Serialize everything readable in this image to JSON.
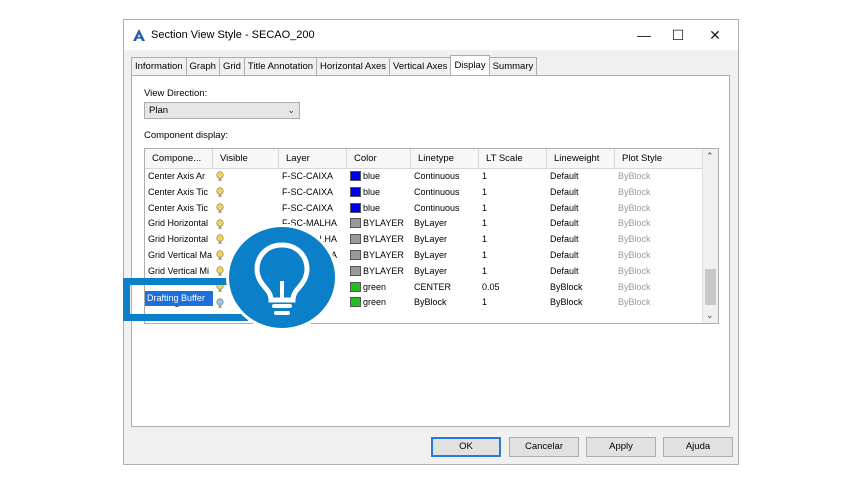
{
  "window": {
    "title": "Section View Style - SECAO_200",
    "minimize_glyph": "—",
    "maximize_glyph": "☐",
    "close_glyph": "✕"
  },
  "tabs": [
    {
      "label": "Information",
      "active": false
    },
    {
      "label": "Graph",
      "active": false
    },
    {
      "label": "Grid",
      "active": false
    },
    {
      "label": "Title Annotation",
      "active": false
    },
    {
      "label": "Horizontal Axes",
      "active": false
    },
    {
      "label": "Vertical Axes",
      "active": false
    },
    {
      "label": "Display",
      "active": true
    },
    {
      "label": "Summary",
      "active": false
    }
  ],
  "display": {
    "view_direction_label": "View Direction:",
    "view_direction_value": "Plan",
    "component_display_label": "Component display:",
    "columns": [
      "Compone...",
      "Visible",
      "Layer",
      "Color",
      "Linetype",
      "LT Scale",
      "Lineweight",
      "Plot Style"
    ],
    "rows": [
      {
        "component": "Center Axis Ar",
        "visible": "on",
        "layer": "F-SC-CAIXA",
        "color": "blue",
        "color_hex": "#0000ee",
        "linetype": "Continuous",
        "lt_scale": "1",
        "lineweight": "Default",
        "plot_style": "ByBlock"
      },
      {
        "component": "Center Axis Tic",
        "visible": "on",
        "layer": "F-SC-CAIXA",
        "color": "blue",
        "color_hex": "#0000ee",
        "linetype": "Continuous",
        "lt_scale": "1",
        "lineweight": "Default",
        "plot_style": "ByBlock"
      },
      {
        "component": "Center Axis Tic",
        "visible": "on",
        "layer": "F-SC-CAIXA",
        "color": "blue",
        "color_hex": "#0000ee",
        "linetype": "Continuous",
        "lt_scale": "1",
        "lineweight": "Default",
        "plot_style": "ByBlock"
      },
      {
        "component": "Grid Horizontal",
        "visible": "on",
        "layer": "F-SC-MALHA",
        "color": "BYLAYER",
        "color_hex": "#9a9a9a",
        "linetype": "ByLayer",
        "lt_scale": "1",
        "lineweight": "Default",
        "plot_style": "ByBlock"
      },
      {
        "component": "Grid Horizontal",
        "visible": "on",
        "layer": "F-SC-MALHA",
        "color": "BYLAYER",
        "color_hex": "#9a9a9a",
        "linetype": "ByLayer",
        "lt_scale": "1",
        "lineweight": "Default",
        "plot_style": "ByBlock"
      },
      {
        "component": "Grid Vertical Ma",
        "visible": "on",
        "layer": "F-SC-MALHA",
        "color": "BYLAYER",
        "color_hex": "#9a9a9a",
        "linetype": "ByLayer",
        "lt_scale": "1",
        "lineweight": "Default",
        "plot_style": "ByBlock"
      },
      {
        "component": "Grid Vertical Mi",
        "visible": "on",
        "layer": "F-SC-MALHA",
        "color": "BYLAYER",
        "color_hex": "#9a9a9a",
        "linetype": "ByLayer",
        "lt_scale": "1",
        "lineweight": "Default",
        "plot_style": "ByBlock"
      },
      {
        "component": "",
        "visible": "on",
        "layer": "",
        "color": "green",
        "color_hex": "#1fc01f",
        "linetype": "CENTER",
        "lt_scale": "0.05",
        "lineweight": "ByBlock",
        "plot_style": "ByBlock"
      },
      {
        "component": "Drafting Buffer",
        "visible": "off",
        "layer": "",
        "color": "green",
        "color_hex": "#1fc01f",
        "linetype": "ByBlock",
        "lt_scale": "1",
        "lineweight": "ByBlock",
        "plot_style": "ByBlock"
      }
    ]
  },
  "buttons": {
    "ok": "OK",
    "cancel": "Cancelar",
    "apply": "Apply",
    "help": "Ajuda"
  },
  "colors": {
    "accent": "#0b7fc7",
    "selection": "#1e6fd9",
    "bulb_on": "#f3d54a",
    "bulb_off": "#9fc2dc"
  },
  "icons": {
    "app": "autocad-a-icon",
    "magnifier": "lightbulb-icon"
  }
}
